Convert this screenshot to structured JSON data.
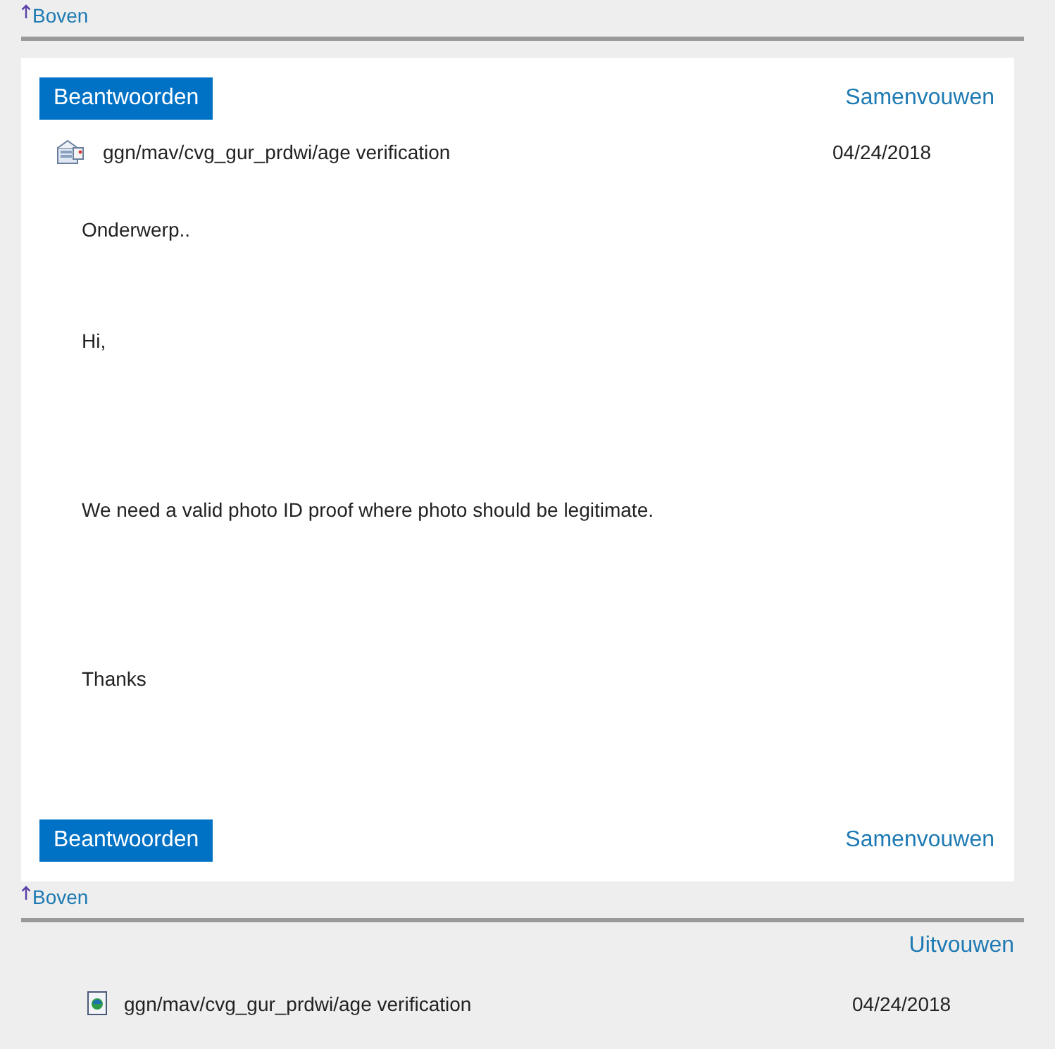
{
  "messages": [
    {
      "top_link": "Boven",
      "expanded": true,
      "reply_label": "Beantwoorden",
      "toggle_label": "Samenvouwen",
      "subject": "ggn/mav/cvg_gur_prdwi/age verification",
      "date": "04/24/2018",
      "body": [
        "Onderwerp..",
        "Hi,",
        "We need a valid photo ID proof where photo should be legitimate.",
        "Thanks"
      ],
      "footer_reply_label": "Beantwoorden",
      "footer_toggle_label": "Samenvouwen"
    },
    {
      "top_link": "Boven",
      "expanded": false,
      "toggle_label": "Uitvouwen",
      "subject": "ggn/mav/cvg_gur_prdwi/age verification",
      "date": "04/24/2018"
    }
  ]
}
